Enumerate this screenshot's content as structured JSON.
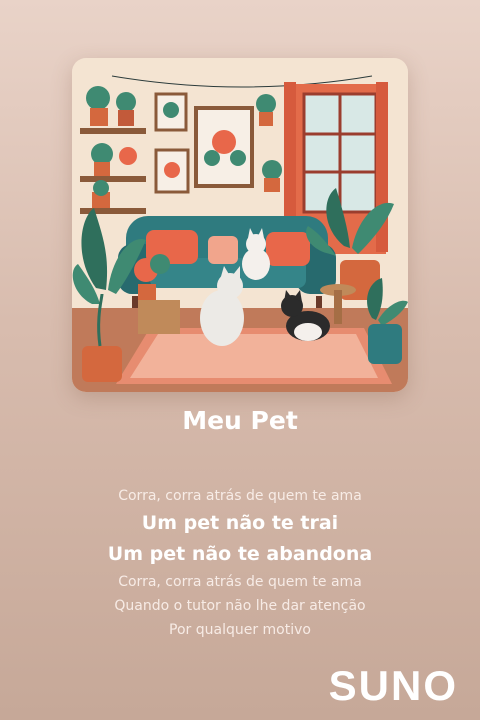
{
  "song": {
    "title": "Meu Pet"
  },
  "lyrics": {
    "lines": [
      {
        "text": "Corra, corra atrás de quem te ama",
        "state": "dim"
      },
      {
        "text": "Um pet não te trai",
        "state": "active"
      },
      {
        "text": "Um pet não te abandona",
        "state": "active"
      },
      {
        "text": "Corra, corra atrás de quem te ama",
        "state": "dim"
      },
      {
        "text": "Quando o tutor não lhe dar atenção",
        "state": "dim"
      },
      {
        "text": "Por qualquer motivo",
        "state": "dim"
      }
    ]
  },
  "brand": {
    "logo_text": "SUNO"
  },
  "colors": {
    "background": "#d8bcae",
    "sofa": "#2f7b7f",
    "cushion": "#e8674a",
    "text": "#ffffff"
  },
  "icons": {
    "cover": "cover-art-living-room-with-cats"
  }
}
